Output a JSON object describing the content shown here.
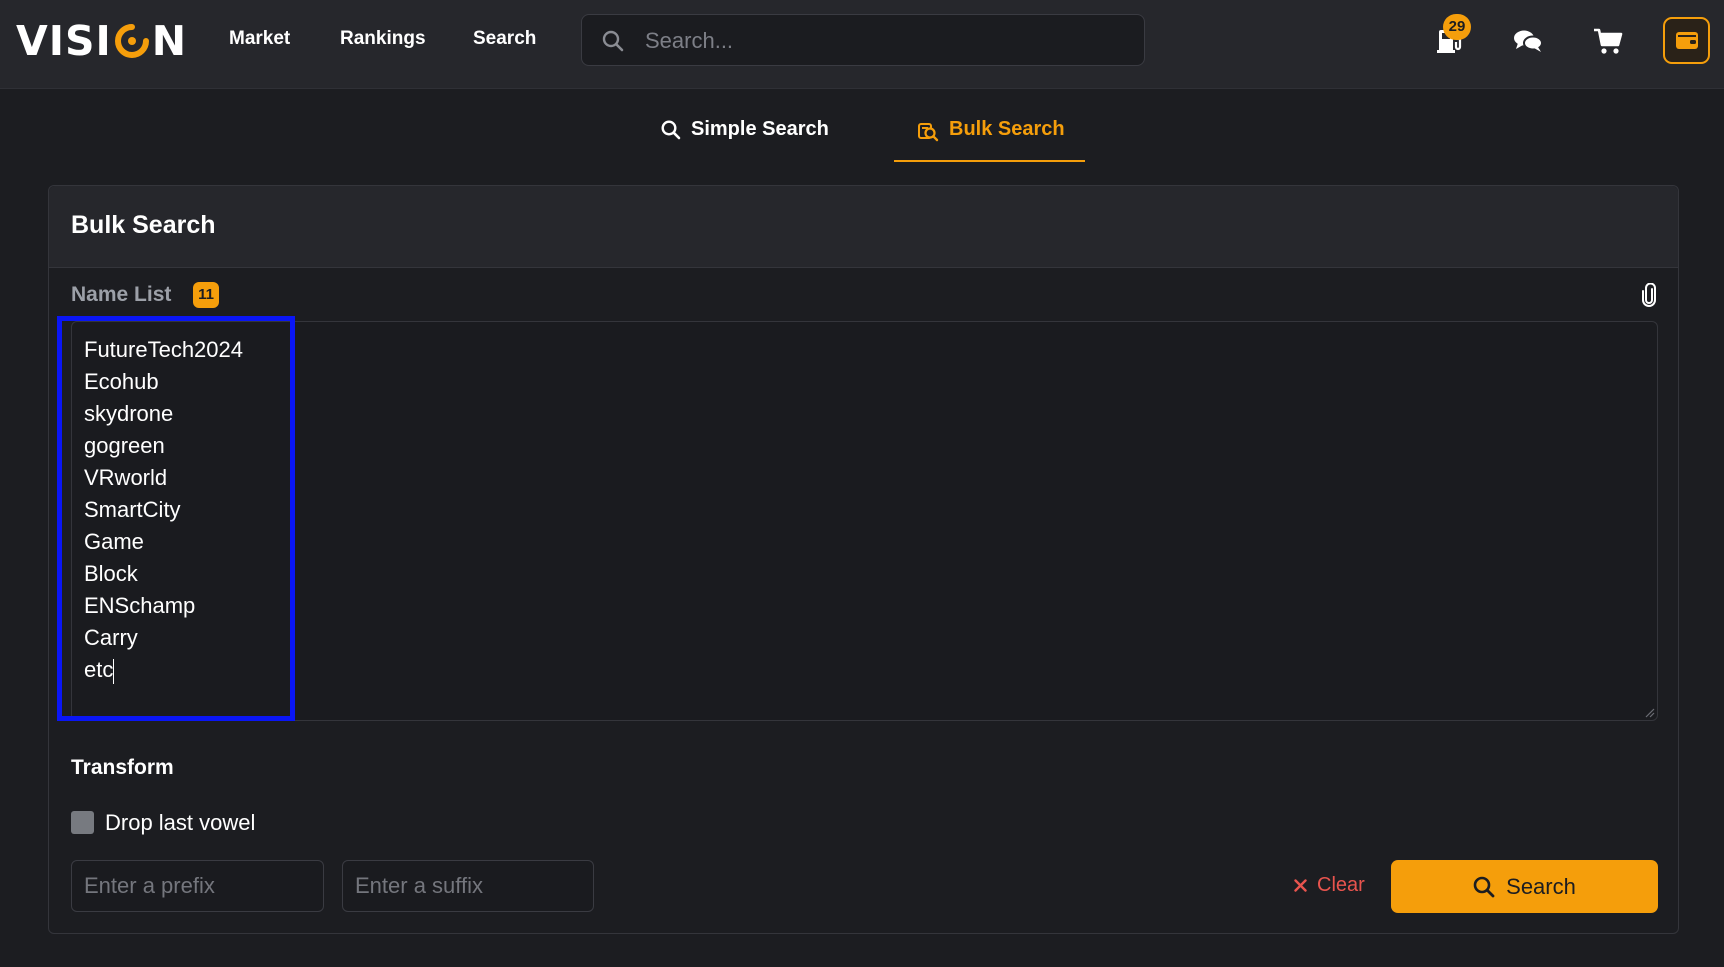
{
  "header": {
    "logo_text_left": "VISI",
    "logo_text_right": "N",
    "nav": [
      "Market",
      "Rankings",
      "Search"
    ],
    "search_placeholder": "Search...",
    "notification_count": "29",
    "icons": [
      "gas-pump-icon",
      "chat-icon",
      "cart-icon",
      "wallet-icon"
    ]
  },
  "tabs": {
    "simple_label": "Simple Search",
    "bulk_label": "Bulk Search",
    "active": "Bulk Search"
  },
  "panel": {
    "title": "Bulk Search",
    "name_list_label": "Name List",
    "name_count": "11",
    "names": [
      "FutureTech2024",
      "Ecohub",
      "skydrone",
      "gogreen",
      "VRworld",
      "SmartCity",
      "Game",
      "Block",
      "ENSchamp",
      "Carry",
      "etc"
    ],
    "transform_title": "Transform",
    "drop_vowel_label": "Drop last vowel",
    "drop_vowel_checked": false,
    "prefix_placeholder": "Enter a prefix",
    "suffix_placeholder": "Enter a suffix",
    "clear_label": "Clear",
    "search_label": "Search"
  },
  "colors": {
    "accent": "#f59e0b",
    "background": "#1c1d21",
    "danger": "#e8544e",
    "highlight": "#0a16f5"
  }
}
